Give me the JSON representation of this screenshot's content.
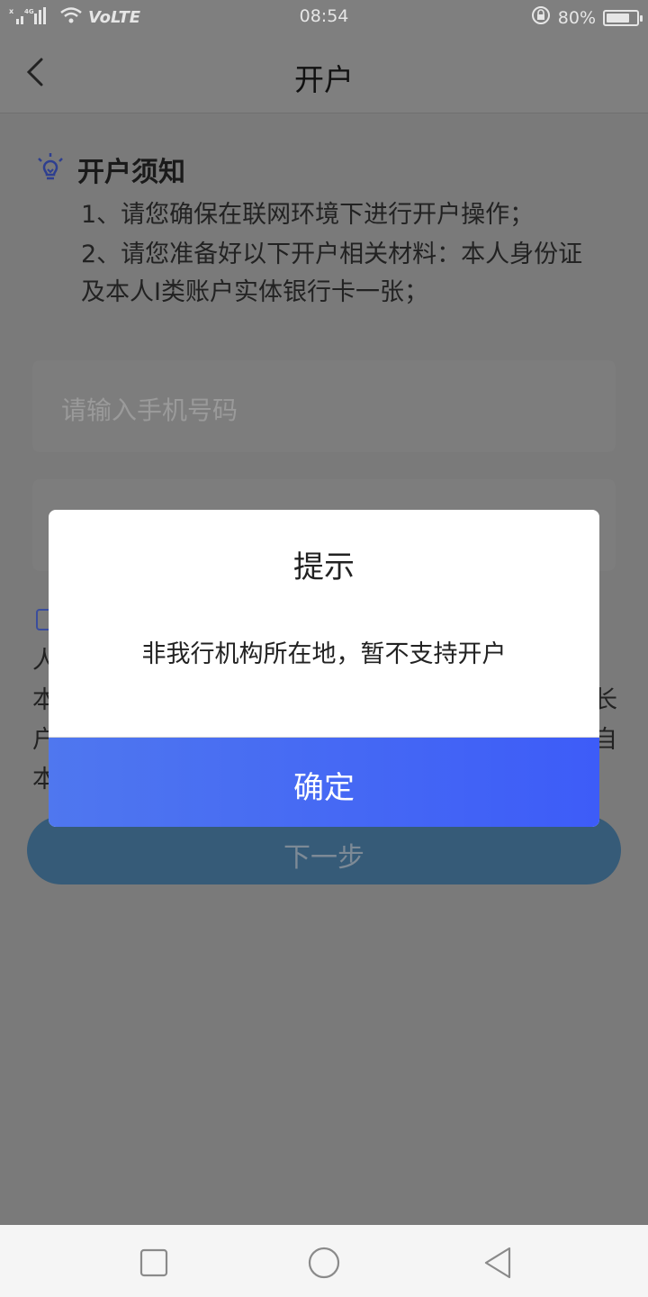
{
  "status_bar": {
    "network": "VoLTE",
    "signal_tag": "4G",
    "time": "08:54",
    "battery": "80%",
    "battery_level": 0.8
  },
  "nav": {
    "title": "开户"
  },
  "notice": {
    "title": "开户须知",
    "line1": "1、请您确保在联网环境下进行开户操作；",
    "line2": "2、请您准备好以下开户相关材料：本人身份证",
    "line3": "及本人I类账户实体银行卡一张；"
  },
  "form": {
    "phone_placeholder": "请输入手机号码"
  },
  "agreement_fragments": {
    "row1": "人",
    "row2_left": "本",
    "row2_right": "长",
    "row3_left": "户",
    "row3_right": "自",
    "row4_left": "本"
  },
  "next_button": "下一步",
  "dialog": {
    "title": "提示",
    "message": "非我行机构所在地，暂不支持开户",
    "confirm": "确定"
  },
  "colors": {
    "accent_start": "#4f77ef",
    "accent_end": "#3d5cf8",
    "next_button_bg": "#365b78",
    "overlay": "#7a7a7a"
  }
}
